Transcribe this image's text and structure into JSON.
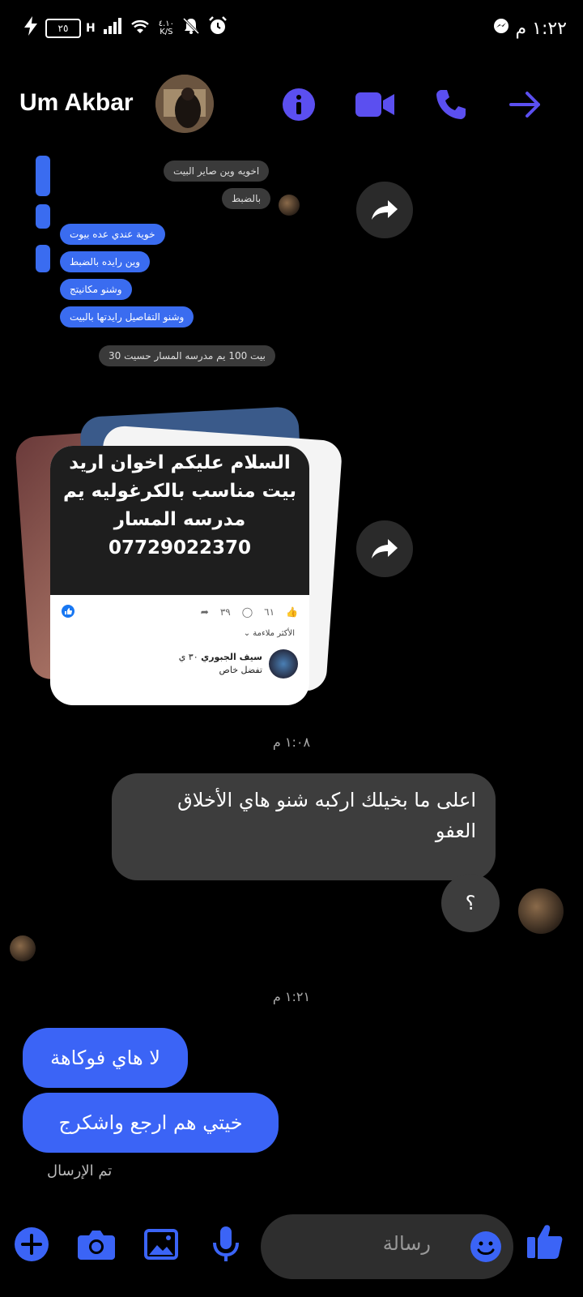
{
  "status_bar": {
    "time": "١:٢٢ م",
    "battery": "٢٥",
    "network": "H",
    "speed_top": "٤.١٠",
    "speed_bottom": "K/S"
  },
  "header": {
    "contact_name": "Um Akbar"
  },
  "shared_screenshot": {
    "gray_messages": [
      "اخويه وين صاير البيت",
      "بالضبط"
    ],
    "blue_messages": [
      "خوية عندي عده بيوت",
      "وين رايده بالضبط",
      "وشنو مكانيتج",
      "وشنو التفاصيل رايدتها بالبيت"
    ],
    "bottom_message": "بيت 100 يم مدرسه المسار حسيت 30"
  },
  "shared_post": {
    "text_lines": [
      "السلام عليكم اخوان اريد",
      "بيت مناسب  بالكرغوليه يم",
      "مدرسه المسار",
      "07729022370"
    ],
    "likes": "٦١",
    "comments": "٣٩",
    "sort_label": "الأكثر ملاءمة",
    "commenter_name": "سيف الجبوري",
    "commenter_time": "٣٠ ي",
    "comment_text": "تفضل خاص"
  },
  "conversation": {
    "timestamp_1": "١:٠٨ م",
    "message_1_line1": "اعلى ما بخيلك اركبه شنو هاي الأخلاق",
    "message_1_line2": "العفو",
    "message_2": "؟",
    "timestamp_2": "١:٢١ م",
    "message_3": "لا هاي فوكاهة",
    "message_4": "خيتي هم ارجع واشكرج",
    "sent_status": "تم الإرسال"
  },
  "composer": {
    "placeholder": "رسالة"
  },
  "colors": {
    "accent": "#3b64f6",
    "icon": "#5b4ff0",
    "gray_bubble": "#3d3d3d"
  }
}
